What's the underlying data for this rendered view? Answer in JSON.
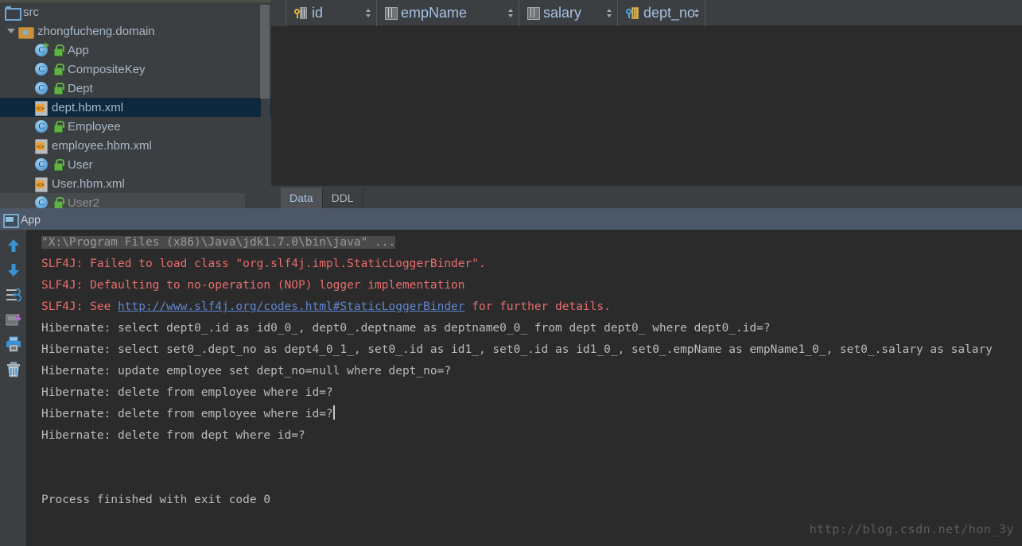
{
  "project_tree": {
    "rows": [
      {
        "label": "src",
        "icon": "folder-blue-icon",
        "indent": 0,
        "twisty": false,
        "state": "normal"
      },
      {
        "label": "zhongfucheng.domain",
        "icon": "package-folder-icon",
        "indent": 1,
        "twisty": true,
        "state": "normal"
      },
      {
        "label": "App",
        "icon": "java-class-runnable-icon",
        "indent": 2,
        "twisty": false,
        "state": "normal"
      },
      {
        "label": "CompositeKey",
        "icon": "java-class-icon",
        "indent": 2,
        "twisty": false,
        "state": "normal"
      },
      {
        "label": "Dept",
        "icon": "java-class-icon",
        "indent": 2,
        "twisty": false,
        "state": "normal"
      },
      {
        "label": "dept.hbm.xml",
        "icon": "xml-file-icon",
        "indent": 2,
        "twisty": false,
        "state": "selected"
      },
      {
        "label": "Employee",
        "icon": "java-class-icon",
        "indent": 2,
        "twisty": false,
        "state": "normal"
      },
      {
        "label": "employee.hbm.xml",
        "icon": "xml-file-icon",
        "indent": 2,
        "twisty": false,
        "state": "normal"
      },
      {
        "label": "User",
        "icon": "java-class-icon",
        "indent": 2,
        "twisty": false,
        "state": "normal"
      },
      {
        "label": "User.hbm.xml",
        "icon": "xml-file-icon",
        "indent": 2,
        "twisty": false,
        "state": "normal"
      },
      {
        "label": "User2",
        "icon": "java-class-icon",
        "indent": 2,
        "twisty": false,
        "state": "hovered"
      }
    ]
  },
  "data_table": {
    "columns": [
      {
        "label": "id",
        "icon": "primary-key-column-icon"
      },
      {
        "label": "empName",
        "icon": "column-icon"
      },
      {
        "label": "salary",
        "icon": "column-icon"
      },
      {
        "label": "dept_no",
        "icon": "foreign-key-column-icon"
      }
    ],
    "rows": [],
    "tabs": [
      {
        "label": "Data",
        "active": true
      },
      {
        "label": "DDL",
        "active": false
      }
    ]
  },
  "run_window": {
    "title": "App",
    "toolbar": [
      {
        "name": "scroll-up-button",
        "icon": "arrow-up-icon"
      },
      {
        "name": "scroll-down-button",
        "icon": "arrow-down-icon"
      },
      {
        "name": "soft-wrap-button",
        "icon": "soft-wrap-icon"
      },
      {
        "name": "export-to-file-button",
        "icon": "export-icon"
      },
      {
        "name": "print-button",
        "icon": "printer-icon"
      },
      {
        "name": "clear-all-button",
        "icon": "trash-icon"
      }
    ],
    "console_lines": [
      {
        "kind": "command",
        "highlight": true,
        "text": "\"X:\\Program Files (x86)\\Java\\jdk1.7.0\\bin\\java\" ..."
      },
      {
        "kind": "error",
        "text": "SLF4J: Failed to load class \"org.slf4j.impl.StaticLoggerBinder\"."
      },
      {
        "kind": "error",
        "text": "SLF4J: Defaulting to no-operation (NOP) logger implementation"
      },
      {
        "kind": "error-link",
        "prefix": "SLF4J: See ",
        "link": "http://www.slf4j.org/codes.html#StaticLoggerBinder",
        "suffix": " for further details."
      },
      {
        "kind": "plain",
        "text": "Hibernate: select dept0_.id as id0_0_, dept0_.deptname as deptname0_0_ from dept dept0_ where dept0_.id=?"
      },
      {
        "kind": "plain",
        "text": "Hibernate: select set0_.dept_no as dept4_0_1_, set0_.id as id1_, set0_.id as id1_0_, set0_.empName as empName1_0_, set0_.salary as salary"
      },
      {
        "kind": "plain",
        "text": "Hibernate: update employee set dept_no=null where dept_no=?"
      },
      {
        "kind": "plain",
        "text": "Hibernate: delete from employee where id=?"
      },
      {
        "kind": "plain-caret",
        "text": "Hibernate: delete from employee where id=?"
      },
      {
        "kind": "plain",
        "text": "Hibernate: delete from dept where id=?"
      },
      {
        "kind": "blank",
        "text": ""
      },
      {
        "kind": "blank",
        "text": ""
      },
      {
        "kind": "plain",
        "text": "Process finished with exit code 0"
      }
    ]
  },
  "watermark": {
    "text": "http://blog.csdn.net/hon_3y"
  },
  "colors": {
    "panel_bg": "#3c3f41",
    "editor_bg": "#2b2b2b",
    "selection_bg": "#0d293e",
    "appbar_bg": "#4c5867",
    "error_text": "#ea6c6c",
    "link_text": "#5f86d0",
    "header_text": "#a4c0e4",
    "body_text": "#bbbbbb"
  }
}
